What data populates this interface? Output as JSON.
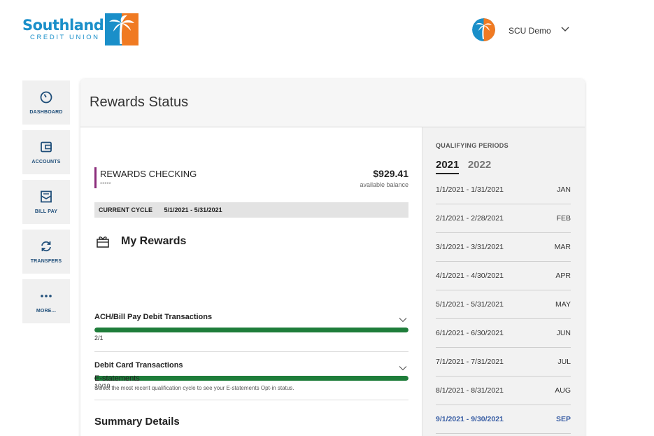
{
  "brand": {
    "name": "Southland",
    "subtitle": "CREDIT UNION",
    "primary_color": "#1a8fc9",
    "accent_color": "#f07a22"
  },
  "user": {
    "name": "SCU Demo"
  },
  "nav": {
    "items": [
      {
        "label": "DASHBOARD",
        "icon": "gauge-icon"
      },
      {
        "label": "ACCOUNTS",
        "icon": "wallet-icon"
      },
      {
        "label": "BILL PAY",
        "icon": "bill-icon"
      },
      {
        "label": "TRANSFERS",
        "icon": "transfer-icon"
      },
      {
        "label": "MORE...",
        "icon": "more-icon"
      }
    ]
  },
  "page": {
    "title": "Rewards Status"
  },
  "account": {
    "name": "REWARDS CHECKING",
    "mask": "*****",
    "balance": "$929.41",
    "balance_label": "available balance"
  },
  "cycle": {
    "label": "CURRENT CYCLE",
    "range": "5/1/2021 - 5/31/2021"
  },
  "my_rewards": {
    "title": "My Rewards",
    "items": [
      {
        "title": "ACH/Bill Pay Debit Transactions",
        "count": "2/1",
        "progress": 1.0,
        "color": "#1e7d3a"
      },
      {
        "title": "Debit Card Transactions",
        "count": "10/10",
        "progress": 1.0,
        "color": "#1e7d3a"
      }
    ]
  },
  "estatements": {
    "title": "E-statements",
    "description": "Select the most recent qualification cycle to see your E-statements Opt-in status."
  },
  "summary": {
    "title": "Summary Details"
  },
  "qualifying": {
    "title": "QUALIFYING PERIODS",
    "years": [
      "2021",
      "2022"
    ],
    "active_year": "2021",
    "periods": [
      {
        "range": "1/1/2021 - 1/31/2021",
        "month": "JAN"
      },
      {
        "range": "2/1/2021 - 2/28/2021",
        "month": "FEB"
      },
      {
        "range": "3/1/2021 - 3/31/2021",
        "month": "MAR"
      },
      {
        "range": "4/1/2021 - 4/30/2021",
        "month": "APR"
      },
      {
        "range": "5/1/2021 - 5/31/2021",
        "month": "MAY"
      },
      {
        "range": "6/1/2021 - 6/30/2021",
        "month": "JUN"
      },
      {
        "range": "7/1/2021 - 7/31/2021",
        "month": "JUL"
      },
      {
        "range": "8/1/2021 - 8/31/2021",
        "month": "AUG"
      },
      {
        "range": "9/1/2021 - 9/30/2021",
        "month": "SEP",
        "selected": true
      }
    ]
  }
}
